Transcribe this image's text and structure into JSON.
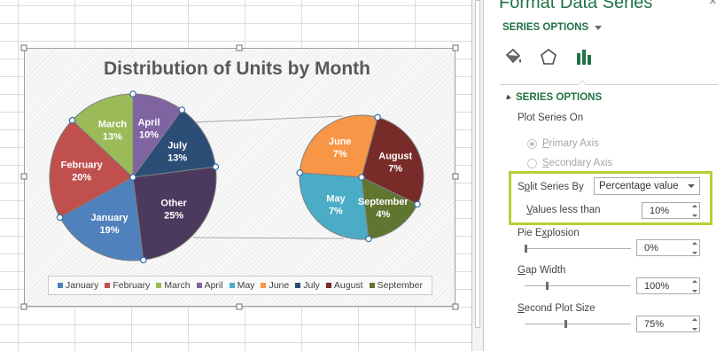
{
  "chart": {
    "title": "Distribution of Units by Month",
    "legend": [
      {
        "label": "January",
        "color": "#4f81bd"
      },
      {
        "label": "February",
        "color": "#c0504d"
      },
      {
        "label": "March",
        "color": "#9bbb59"
      },
      {
        "label": "April",
        "color": "#8064a2"
      },
      {
        "label": "May",
        "color": "#4bacc6"
      },
      {
        "label": "June",
        "color": "#f79646"
      },
      {
        "label": "July",
        "color": "#2c4d75"
      },
      {
        "label": "August",
        "color": "#772c2a"
      },
      {
        "label": "September",
        "color": "#5f7530"
      }
    ],
    "slice_labels": {
      "april": {
        "name": "April",
        "value": "10%"
      },
      "july": {
        "name": "July",
        "value": "13%"
      },
      "march": {
        "name": "March",
        "value": "13%"
      },
      "other": {
        "name": "Other",
        "value": "25%"
      },
      "february": {
        "name": "February",
        "value": "20%"
      },
      "january": {
        "name": "January",
        "value": "19%"
      },
      "august": {
        "name": "August",
        "value": "7%"
      },
      "june": {
        "name": "June",
        "value": "7%"
      },
      "september": {
        "name": "September",
        "value": "4%"
      },
      "may": {
        "name": "May",
        "value": "7%"
      }
    }
  },
  "chart_data": {
    "type": "pie",
    "subtype": "pie-of-pie",
    "title": "Distribution of Units by Month",
    "primary": [
      {
        "name": "April",
        "value": 10,
        "color": "#8064a2"
      },
      {
        "name": "July",
        "value": 13,
        "color": "#2c4d75"
      },
      {
        "name": "Other",
        "value": 25,
        "color": "#4b3a5e"
      },
      {
        "name": "January",
        "value": 19,
        "color": "#4f81bd"
      },
      {
        "name": "February",
        "value": 20,
        "color": "#c0504d"
      },
      {
        "name": "March",
        "value": 13,
        "color": "#9bbb59"
      }
    ],
    "secondary": [
      {
        "name": "August",
        "value": 7,
        "color": "#772c2a"
      },
      {
        "name": "September",
        "value": 4,
        "color": "#5f7530"
      },
      {
        "name": "May",
        "value": 7,
        "color": "#4bacc6"
      },
      {
        "name": "June",
        "value": 7,
        "color": "#f79646"
      }
    ],
    "legend_position": "bottom"
  },
  "pane": {
    "title": "Format Data Series",
    "close_glyph": "×",
    "options_menu": "SERIES OPTIONS",
    "icons": [
      "fill-line-icon",
      "effects-icon",
      "series-options-icon"
    ],
    "section_header": "SERIES OPTIONS",
    "plot_series_on": "Plot Series On",
    "primary_axis": "Primary Axis",
    "secondary_axis": "Secondary Axis",
    "split_series_by_label": "Split Series By",
    "split_series_by_value": "Percentage value",
    "values_less_than_label": "Values less than",
    "values_less_than_value": "10%",
    "pie_explosion_label": "Pie Explosion",
    "pie_explosion_value": "0%",
    "pie_explosion_level": 0,
    "gap_width_label": "Gap Width",
    "gap_width_value": "100%",
    "gap_width_level": 0.2,
    "second_plot_size_label": "Second Plot Size",
    "second_plot_size_value": "75%",
    "second_plot_size_level": 0.375,
    "highlight_color": "#b2d235"
  }
}
